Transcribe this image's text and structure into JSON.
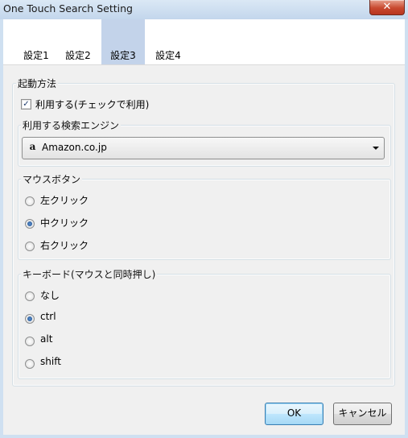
{
  "window": {
    "title": "One Touch Search Setting",
    "close_label": "✕"
  },
  "tabs": [
    {
      "label": "設定1"
    },
    {
      "label": "設定2"
    },
    {
      "label": "設定3",
      "active": true
    },
    {
      "label": "設定4"
    }
  ],
  "launch": {
    "group_label": "起動方法",
    "use_checkbox": {
      "label": "利用する(チェックで利用)",
      "checked": true
    }
  },
  "engine": {
    "group_label": "利用する検索エンジン",
    "selected": "Amazon.co.jp",
    "icon": "a"
  },
  "mouse_button": {
    "group_label": "マウスボタン",
    "options": [
      "左クリック",
      "中クリック",
      "右クリック"
    ],
    "selected_index": 1
  },
  "keyboard": {
    "group_label": "キーボード(マウスと同時押し)",
    "options": [
      "なし",
      "ctrl",
      "alt",
      "shift"
    ],
    "selected_index": 1
  },
  "buttons": {
    "ok": "OK",
    "cancel": "キャンセル"
  },
  "colors": {
    "active_tab": "#c3d3ea",
    "title_bar": "#c3d6ec",
    "close_button": "#c8492f"
  }
}
